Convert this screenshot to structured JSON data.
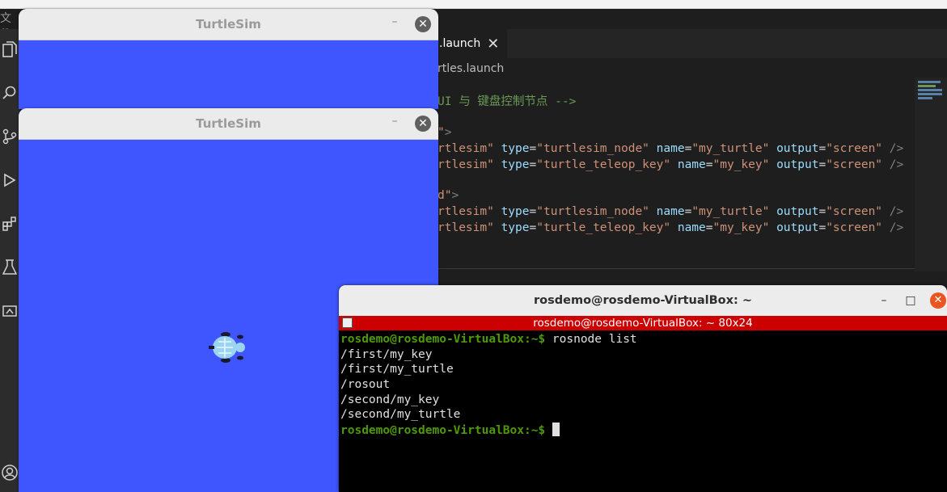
{
  "menu": {
    "file_glyph": "文件"
  },
  "activitybar": {
    "icons": [
      "files-icon",
      "search-icon",
      "source-control-icon",
      "run-debug-icon",
      "extensions-icon",
      "testing-icon",
      "remote-explorer-icon",
      "account-icon"
    ]
  },
  "editor": {
    "tab_label": ".launch",
    "tab_close": "✕",
    "breadcrumb": "rtles.launch",
    "lines": [
      {
        "kind": "comment",
        "text": "UI 与 键盘控制节点 -->"
      },
      {
        "kind": "group",
        "text": "\">"
      },
      {
        "kind": "node",
        "pkg": "rtlesim\"",
        "type": "\"turtlesim_node\"",
        "name": "\"my_turtle\"",
        "output": "\"screen\""
      },
      {
        "kind": "node",
        "pkg": "rtlesim\"",
        "type": "\"turtle_teleop_key\"",
        "name": "\"my_key\"",
        "output": "\"screen\""
      },
      {
        "kind": "group",
        "text": "d\">"
      },
      {
        "kind": "node",
        "pkg": "rtlesim\"",
        "type": "\"turtlesim_node\"",
        "name": "\"my_turtle\"",
        "output": "\"screen\""
      },
      {
        "kind": "node",
        "pkg": "rtlesim\"",
        "type": "\"turtle_teleop_key\"",
        "name": "\"my_key\"",
        "output": "\"screen\""
      }
    ]
  },
  "turtlesim_windows": [
    {
      "title": "TurtleSim",
      "min": "–",
      "close": "✕"
    },
    {
      "title": "TurtleSim",
      "min": "–",
      "close": "✕"
    }
  ],
  "terminal": {
    "title": "rosdemo@rosdemo-VirtualBox: ~",
    "min": "–",
    "max": "□",
    "close": "✕",
    "sub_title": "rosdemo@rosdemo-VirtualBox: ~ 80x24",
    "prompt": "rosdemo@rosdemo-VirtualBox:~$",
    "command": " rosnode list",
    "output": [
      "/first/my_key",
      "/first/my_turtle",
      "/rosout",
      "/second/my_key",
      "/second/my_turtle"
    ]
  },
  "colors": {
    "turtlesim_bg": "#3f56ff",
    "terminal_bg": "#000000",
    "prompt_green": "#4e9a06",
    "terminal_accent": "#cc0000"
  }
}
